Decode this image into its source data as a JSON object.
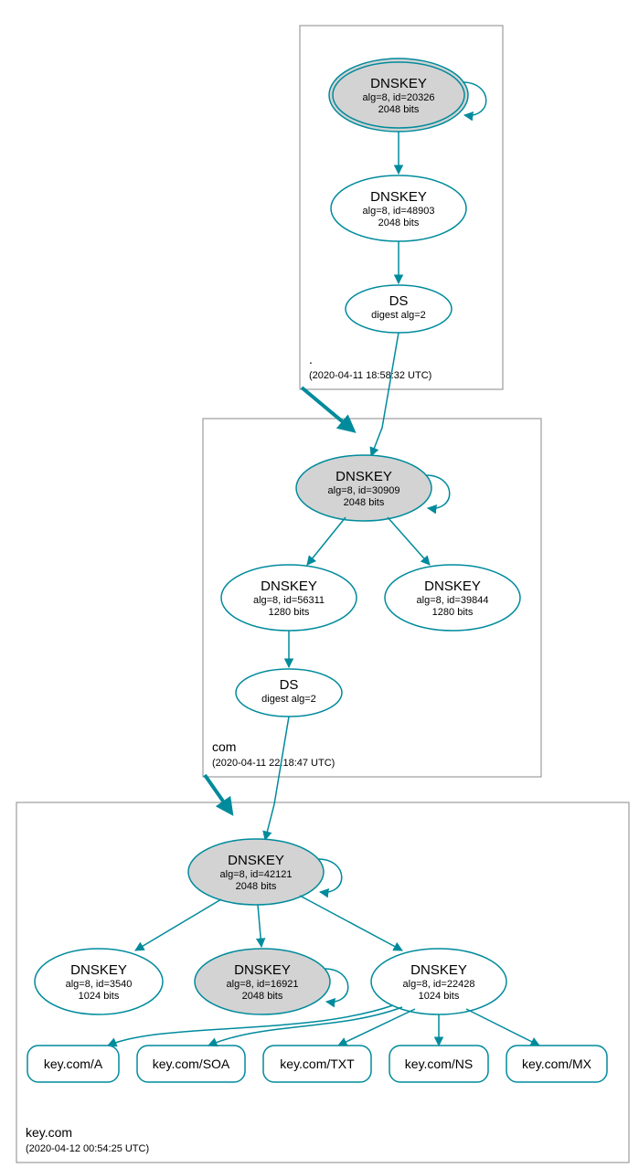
{
  "chart_data": {
    "type": "graph",
    "zones": [
      {
        "name": ".",
        "timestamp": "(2020-04-11 18:58:32 UTC)",
        "nodes": [
          {
            "id": "root-ksk",
            "type": "DNSKEY",
            "alg": "alg=8, id=20326",
            "bits": "2048 bits",
            "shaded": true,
            "double": true
          },
          {
            "id": "root-zsk",
            "type": "DNSKEY",
            "alg": "alg=8, id=48903",
            "bits": "2048 bits"
          },
          {
            "id": "root-ds",
            "type": "DS",
            "alg": "digest alg=2"
          }
        ]
      },
      {
        "name": "com",
        "timestamp": "(2020-04-11 22:18:47 UTC)",
        "nodes": [
          {
            "id": "com-ksk",
            "type": "DNSKEY",
            "alg": "alg=8, id=30909",
            "bits": "2048 bits",
            "shaded": true
          },
          {
            "id": "com-zsk1",
            "type": "DNSKEY",
            "alg": "alg=8, id=56311",
            "bits": "1280 bits"
          },
          {
            "id": "com-zsk2",
            "type": "DNSKEY",
            "alg": "alg=8, id=39844",
            "bits": "1280 bits"
          },
          {
            "id": "com-ds",
            "type": "DS",
            "alg": "digest alg=2"
          }
        ]
      },
      {
        "name": "key.com",
        "timestamp": "(2020-04-12 00:54:25 UTC)",
        "nodes": [
          {
            "id": "key-ksk",
            "type": "DNSKEY",
            "alg": "alg=8, id=42121",
            "bits": "2048 bits",
            "shaded": true
          },
          {
            "id": "key-zsk1",
            "type": "DNSKEY",
            "alg": "alg=8, id=3540",
            "bits": "1024 bits"
          },
          {
            "id": "key-zsk2",
            "type": "DNSKEY",
            "alg": "alg=8, id=16921",
            "bits": "2048 bits",
            "shaded": true
          },
          {
            "id": "key-zsk3",
            "type": "DNSKEY",
            "alg": "alg=8, id=22428",
            "bits": "1024 bits"
          }
        ],
        "records": [
          "key.com/A",
          "key.com/SOA",
          "key.com/TXT",
          "key.com/NS",
          "key.com/MX"
        ]
      }
    ]
  },
  "zones": {
    "root": {
      "label": ".",
      "timestamp": "(2020-04-11 18:58:32 UTC)"
    },
    "com": {
      "label": "com",
      "timestamp": "(2020-04-11 22:18:47 UTC)"
    },
    "key": {
      "label": "key.com",
      "timestamp": "(2020-04-12 00:54:25 UTC)"
    }
  },
  "nodes": {
    "root_ksk": {
      "title": "DNSKEY",
      "l1": "alg=8, id=20326",
      "l2": "2048 bits"
    },
    "root_zsk": {
      "title": "DNSKEY",
      "l1": "alg=8, id=48903",
      "l2": "2048 bits"
    },
    "root_ds": {
      "title": "DS",
      "l1": "digest alg=2"
    },
    "com_ksk": {
      "title": "DNSKEY",
      "l1": "alg=8, id=30909",
      "l2": "2048 bits"
    },
    "com_z1": {
      "title": "DNSKEY",
      "l1": "alg=8, id=56311",
      "l2": "1280 bits"
    },
    "com_z2": {
      "title": "DNSKEY",
      "l1": "alg=8, id=39844",
      "l2": "1280 bits"
    },
    "com_ds": {
      "title": "DS",
      "l1": "digest alg=2"
    },
    "key_ksk": {
      "title": "DNSKEY",
      "l1": "alg=8, id=42121",
      "l2": "2048 bits"
    },
    "key_z1": {
      "title": "DNSKEY",
      "l1": "alg=8, id=3540",
      "l2": "1024 bits"
    },
    "key_z2": {
      "title": "DNSKEY",
      "l1": "alg=8, id=16921",
      "l2": "2048 bits"
    },
    "key_z3": {
      "title": "DNSKEY",
      "l1": "alg=8, id=22428",
      "l2": "1024 bits"
    }
  },
  "records": {
    "a": "key.com/A",
    "soa": "key.com/SOA",
    "txt": "key.com/TXT",
    "ns": "key.com/NS",
    "mx": "key.com/MX"
  }
}
